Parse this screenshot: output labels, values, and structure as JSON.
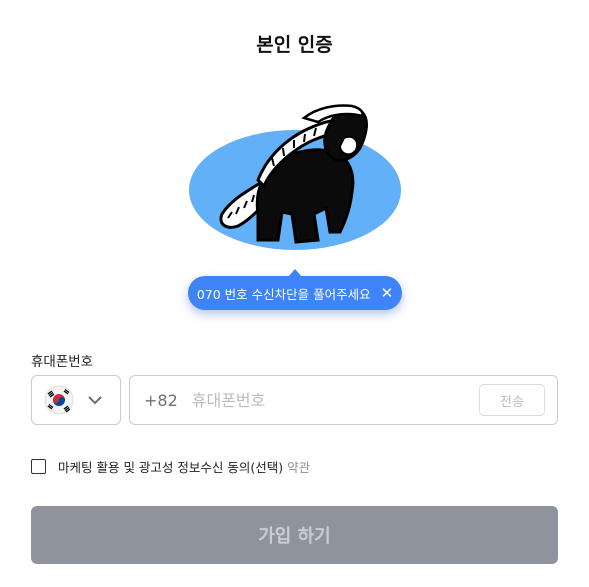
{
  "page": {
    "title": "본인 인증"
  },
  "tooltip": {
    "text": "070 번호 수신차단을 풀어주세요",
    "close_glyph": "✕"
  },
  "phone": {
    "label": "휴대폰번호",
    "country_code": "+82",
    "placeholder": "휴대폰번호",
    "value": "",
    "send_label": "전송"
  },
  "consent": {
    "text": "마케팅 활용 및 광고성 정보수신 동의(선택)",
    "link": "약관",
    "checked": false
  },
  "submit": {
    "label": "가입 하기"
  },
  "colors": {
    "accent": "#3f83f8",
    "ellipse": "#62b0f8",
    "disabled_button": "#8f939c"
  }
}
